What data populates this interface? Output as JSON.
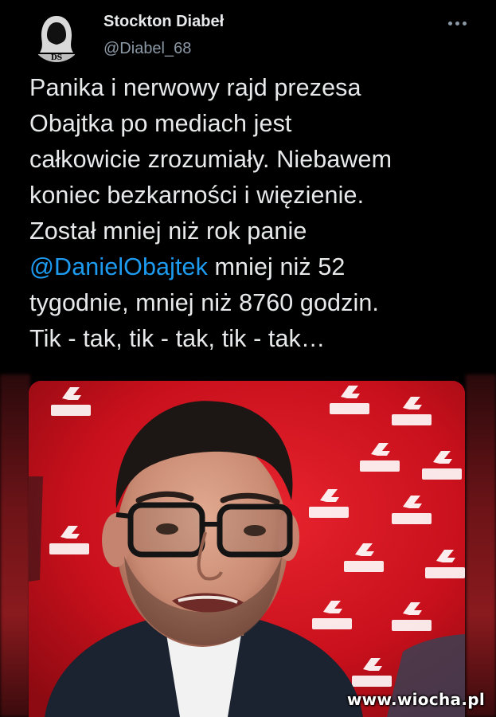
{
  "tweet": {
    "display_name": "Stockton Diabeł",
    "handle": "@Diabel_68",
    "avatar_initials": "DS",
    "lines": [
      "Panika i nerwowy rajd prezesa",
      "Obajtka po mediach jest",
      "całkowicie zrozumiały. Niebawem",
      "koniec bezkarności i więzienie.",
      "Został mniej niż rok panie"
    ],
    "mention": "@DanielObajtek",
    "mention_rest": " mniej niż 52",
    "lines_after": [
      "tygodnie, mniej niż 8760 godzin.",
      "Tik - tak, tik - tak, tik - tak…"
    ]
  },
  "photo": {
    "logo_text": "ORLEN",
    "backdrop_color": "#c8101c"
  },
  "watermark": "www.wiocha.pl"
}
